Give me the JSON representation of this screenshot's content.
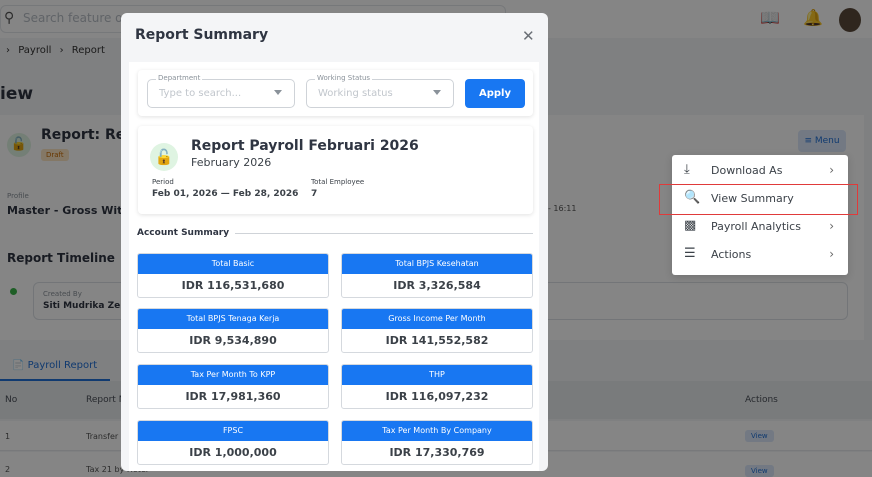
{
  "background": {
    "search_placeholder": "Search feature or s",
    "breadcrumb": [
      "Payroll",
      "Report"
    ],
    "page_title_partial": "iew",
    "report_name_partial": "Report: Rep",
    "status_badge": "Draft",
    "menu_button": "Menu",
    "profile_label": "Profile",
    "profile_value": "Master - Gross With",
    "time_partial": "- 16:11",
    "timeline_title": "Report Timeline",
    "created_by_label": "Created By",
    "created_by_value": "Siti Mudrika Zein",
    "tab_label": "Payroll Report",
    "table_headers": {
      "no": "No",
      "report": "Report N",
      "actions": "Actions"
    },
    "rows": [
      {
        "no": "1",
        "name": "Transfer",
        "action": "View"
      },
      {
        "no": "2",
        "name": "Tax 21 by Hotel",
        "action": "View"
      }
    ]
  },
  "dropdown": {
    "items": [
      {
        "label": "Download As",
        "icon": "download-icon",
        "has_submenu": true
      },
      {
        "label": "View Summary",
        "icon": "file-search-icon",
        "has_submenu": false
      },
      {
        "label": "Payroll Analytics",
        "icon": "chart-icon",
        "has_submenu": true
      },
      {
        "label": "Actions",
        "icon": "sliders-icon",
        "has_submenu": true
      }
    ]
  },
  "modal": {
    "title": "Report Summary",
    "filters": {
      "department": {
        "legend": "Department",
        "placeholder": "Type to search..."
      },
      "working_status": {
        "legend": "Working Status",
        "placeholder": "Working status"
      },
      "apply_label": "Apply"
    },
    "report": {
      "title": "Report Payroll Februari 2026",
      "subtitle": "February 2026",
      "period_label": "Period",
      "period_value": "Feb 01, 2026 — Feb 28, 2026",
      "employees_label": "Total Employee",
      "employees_value": "7"
    },
    "account_summary_title": "Account Summary",
    "summary": [
      {
        "label": "Total Basic",
        "amount": "IDR 116,531,680"
      },
      {
        "label": "Total BPJS Kesehatan",
        "amount": "IDR 3,326,584"
      },
      {
        "label": "Total BPJS Tenaga Kerja",
        "amount": "IDR 9,534,890"
      },
      {
        "label": "Gross Income Per Month",
        "amount": "IDR 141,552,582"
      },
      {
        "label": "Tax Per Month To KPP",
        "amount": "IDR 17,981,360"
      },
      {
        "label": "THP",
        "amount": "IDR 116,097,232"
      },
      {
        "label": "FPSC",
        "amount": "IDR 1,000,000"
      },
      {
        "label": "Tax Per Month By Company",
        "amount": "IDR 17,330,769"
      }
    ]
  },
  "colors": {
    "primary": "#1877f2",
    "success": "#3bb54a",
    "highlight": "#e03a3a"
  }
}
